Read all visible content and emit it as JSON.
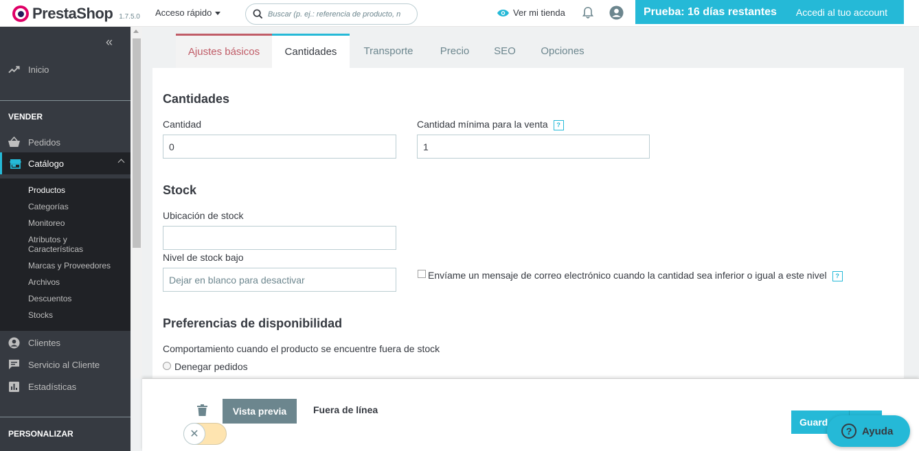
{
  "header": {
    "brand": "PrestaShop",
    "version": "1.7.5.0",
    "quick_access": "Acceso rápido",
    "search_placeholder": "Buscar (p. ej.: referencia de producto, n",
    "view_store": "Ver mi tienda",
    "trial_days": "Prueba: 16 días restantes",
    "trial_account": "Accedi al tuo account"
  },
  "sidebar": {
    "home": "Inicio",
    "sell_section": "VENDER",
    "orders": "Pedidos",
    "catalog": "Catálogo",
    "catalog_items": [
      "Productos",
      "Categorías",
      "Monitoreo",
      "Atributos y\nCaracterísticas",
      "Marcas y Proveedores",
      "Archivos",
      "Descuentos",
      "Stocks"
    ],
    "customers": "Clientes",
    "customer_service": "Servicio al Cliente",
    "stats": "Estadísticas",
    "customize_section": "PERSONALIZAR"
  },
  "tabs": [
    "Ajustes básicos",
    "Cantidades",
    "Transporte",
    "Precio",
    "SEO",
    "Opciones"
  ],
  "form": {
    "quantities_title": "Cantidades",
    "quantity_label": "Cantidad",
    "quantity_value": "0",
    "min_qty_label": "Cantidad mínima para la venta",
    "min_qty_value": "1",
    "help_glyph": "?",
    "stock_title": "Stock",
    "location_label": "Ubicación de stock",
    "location_value": "",
    "low_stock_label": "Nivel de stock bajo",
    "low_stock_placeholder": "Dejar en blanco para desactivar",
    "email_alert_label": "Envíame un mensaje de correo electrónico cuando la cantidad sea inferior o igual a este nivel",
    "availability_title": "Preferencias de disponibilidad",
    "behavior_label": "Comportamiento cuando el producto se encuentre fuera de stock",
    "deny_orders": "Denegar pedidos"
  },
  "footer": {
    "preview": "Vista previa",
    "offline": "Fuera de línea",
    "toggle_glyph": "✕",
    "save": "Guard",
    "help": "Ayuda",
    "help_glyph": "?"
  },
  "colors": {
    "accent": "#25b9d7",
    "sidebar_bg": "#363a41",
    "basic_tab": "#c05c67",
    "toggle_off": "#fee4b0"
  }
}
